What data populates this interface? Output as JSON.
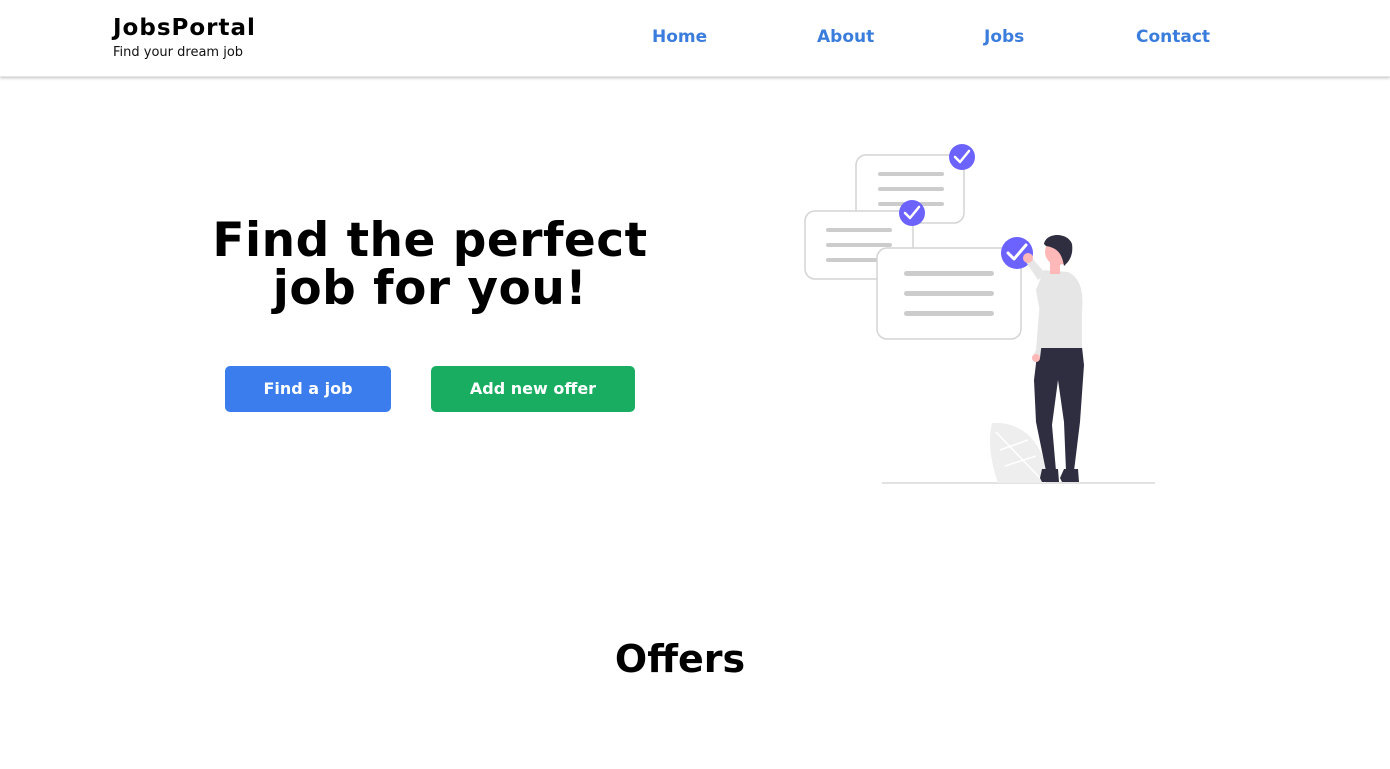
{
  "brand": {
    "name": "JobsPortal",
    "tagline": "Find your dream job"
  },
  "nav": {
    "items": [
      {
        "label": "Home"
      },
      {
        "label": "About"
      },
      {
        "label": "Jobs"
      },
      {
        "label": "Contact"
      }
    ]
  },
  "hero": {
    "title_line1": "Find the perfect",
    "title_line2": "job for you!",
    "find_button": "Find a job",
    "add_button": "Add new offer",
    "illustration": "person-checking-documents-illustration"
  },
  "offers": {
    "title": "Offers"
  },
  "colors": {
    "nav_link": "#3b7ddd",
    "primary_button": "#3b7ded",
    "success_button": "#19ad62",
    "check_accent": "#6c63ff"
  }
}
